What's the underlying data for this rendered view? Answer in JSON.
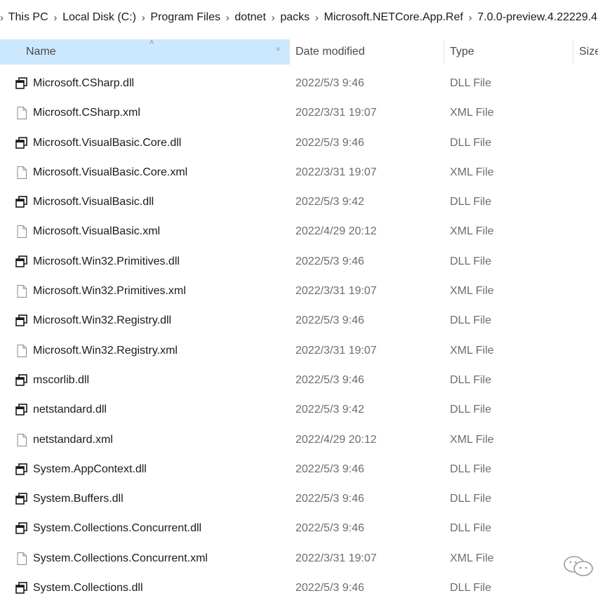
{
  "breadcrumb": {
    "items": [
      "This PC",
      "Local Disk (C:)",
      "Program Files",
      "dotnet",
      "packs",
      "Microsoft.NETCore.App.Ref",
      "7.0.0-preview.4.22229.4"
    ]
  },
  "columns": {
    "name": "Name",
    "date_modified": "Date modified",
    "type": "Type",
    "size": "Size"
  },
  "files": [
    {
      "name": "Microsoft.CSharp.dll",
      "date": "2022/5/3 9:46",
      "type": "DLL File",
      "icon": "dll-file-icon"
    },
    {
      "name": "Microsoft.CSharp.xml",
      "date": "2022/3/31 19:07",
      "type": "XML File",
      "icon": "blank-file-icon"
    },
    {
      "name": "Microsoft.VisualBasic.Core.dll",
      "date": "2022/5/3 9:46",
      "type": "DLL File",
      "icon": "dll-file-icon"
    },
    {
      "name": "Microsoft.VisualBasic.Core.xml",
      "date": "2022/3/31 19:07",
      "type": "XML File",
      "icon": "blank-file-icon"
    },
    {
      "name": "Microsoft.VisualBasic.dll",
      "date": "2022/5/3 9:42",
      "type": "DLL File",
      "icon": "dll-file-icon"
    },
    {
      "name": "Microsoft.VisualBasic.xml",
      "date": "2022/4/29 20:12",
      "type": "XML File",
      "icon": "blank-file-icon"
    },
    {
      "name": "Microsoft.Win32.Primitives.dll",
      "date": "2022/5/3 9:46",
      "type": "DLL File",
      "icon": "dll-file-icon"
    },
    {
      "name": "Microsoft.Win32.Primitives.xml",
      "date": "2022/3/31 19:07",
      "type": "XML File",
      "icon": "blank-file-icon"
    },
    {
      "name": "Microsoft.Win32.Registry.dll",
      "date": "2022/5/3 9:46",
      "type": "DLL File",
      "icon": "dll-file-icon"
    },
    {
      "name": "Microsoft.Win32.Registry.xml",
      "date": "2022/3/31 19:07",
      "type": "XML File",
      "icon": "blank-file-icon"
    },
    {
      "name": "mscorlib.dll",
      "date": "2022/5/3 9:46",
      "type": "DLL File",
      "icon": "dll-file-icon"
    },
    {
      "name": "netstandard.dll",
      "date": "2022/5/3 9:42",
      "type": "DLL File",
      "icon": "dll-file-icon"
    },
    {
      "name": "netstandard.xml",
      "date": "2022/4/29 20:12",
      "type": "XML File",
      "icon": "blank-file-icon"
    },
    {
      "name": "System.AppContext.dll",
      "date": "2022/5/3 9:46",
      "type": "DLL File",
      "icon": "dll-file-icon"
    },
    {
      "name": "System.Buffers.dll",
      "date": "2022/5/3 9:46",
      "type": "DLL File",
      "icon": "dll-file-icon"
    },
    {
      "name": "System.Collections.Concurrent.dll",
      "date": "2022/5/3 9:46",
      "type": "DLL File",
      "icon": "dll-file-icon"
    },
    {
      "name": "System.Collections.Concurrent.xml",
      "date": "2022/3/31 19:07",
      "type": "XML File",
      "icon": "blank-file-icon"
    },
    {
      "name": "System.Collections.dll",
      "date": "2022/5/3 9:46",
      "type": "DLL File",
      "icon": "dll-file-icon"
    }
  ],
  "colors": {
    "name_header_bg": "#cce8ff",
    "secondary_text": "#6d6d6d"
  }
}
